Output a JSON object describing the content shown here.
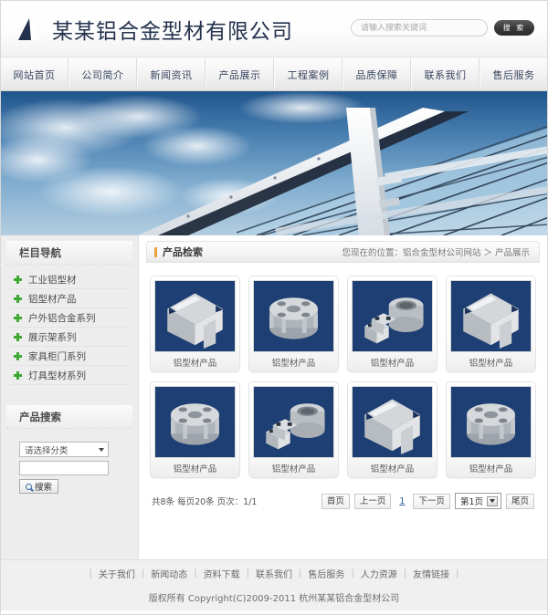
{
  "header": {
    "logo_icon": "triangle-logo-icon",
    "company_name": "某某铝合金型材有限公司",
    "search": {
      "placeholder": "请输入搜索关键词",
      "value": "",
      "button_label": "搜 索"
    }
  },
  "nav": {
    "items": [
      {
        "label": "网站首页"
      },
      {
        "label": "公司简介"
      },
      {
        "label": "新闻资讯"
      },
      {
        "label": "产品展示"
      },
      {
        "label": "工程案例"
      },
      {
        "label": "品质保障"
      },
      {
        "label": "联系我们"
      },
      {
        "label": "售后服务"
      }
    ]
  },
  "banner": {
    "alt": "蓝天白云下的玻璃幕墙雨棚建筑"
  },
  "sidebar": {
    "nav_title": "栏目导航",
    "nav_items": [
      {
        "label": "工业铝型材"
      },
      {
        "label": "铝型材产品"
      },
      {
        "label": "户外铝合金系列"
      },
      {
        "label": "展示架系列"
      },
      {
        "label": "家具柜门系列"
      },
      {
        "label": "灯具型材系列"
      }
    ],
    "search_title": "产品搜索",
    "category_select": "请选择分类",
    "keyword_value": "",
    "keyword_placeholder": "",
    "search_button": "搜索"
  },
  "main": {
    "panel_title": "产品检索",
    "breadcrumb": "您现在的位置：铝合金型材公司网站 ＞ 产品展示",
    "products": [
      {
        "label": "铝型材产品",
        "shape": "angle"
      },
      {
        "label": "铝型材产品",
        "shape": "gear"
      },
      {
        "label": "铝型材产品",
        "shape": "combo"
      },
      {
        "label": "铝型材产品",
        "shape": "angle"
      },
      {
        "label": "铝型材产品",
        "shape": "gear"
      },
      {
        "label": "铝型材产品",
        "shape": "combo"
      },
      {
        "label": "铝型材产品",
        "shape": "angle"
      },
      {
        "label": "铝型材产品",
        "shape": "gear"
      }
    ],
    "pager": {
      "summary": "共8条 每页20条 页次：1/1",
      "first": "首页",
      "prev": "上一页",
      "current_number": "1",
      "next": "下一页",
      "page_select": "第1页",
      "last": "尾页"
    }
  },
  "footer": {
    "links": [
      {
        "label": "关于我们"
      },
      {
        "label": "新闻动态"
      },
      {
        "label": "资料下载"
      },
      {
        "label": "联系我们"
      },
      {
        "label": "售后服务"
      },
      {
        "label": "人力资源"
      },
      {
        "label": "友情链接"
      }
    ],
    "copyright": "版权所有  Copyright(C)2009-2011 杭州某某铝合金型材公司"
  },
  "colors": {
    "brand_navy": "#24324d",
    "thumb_bg": "#1e3f73",
    "accent_orange": "#e8a23b",
    "bullet_green": "#3ea832",
    "link_blue": "#2b5c9b"
  }
}
